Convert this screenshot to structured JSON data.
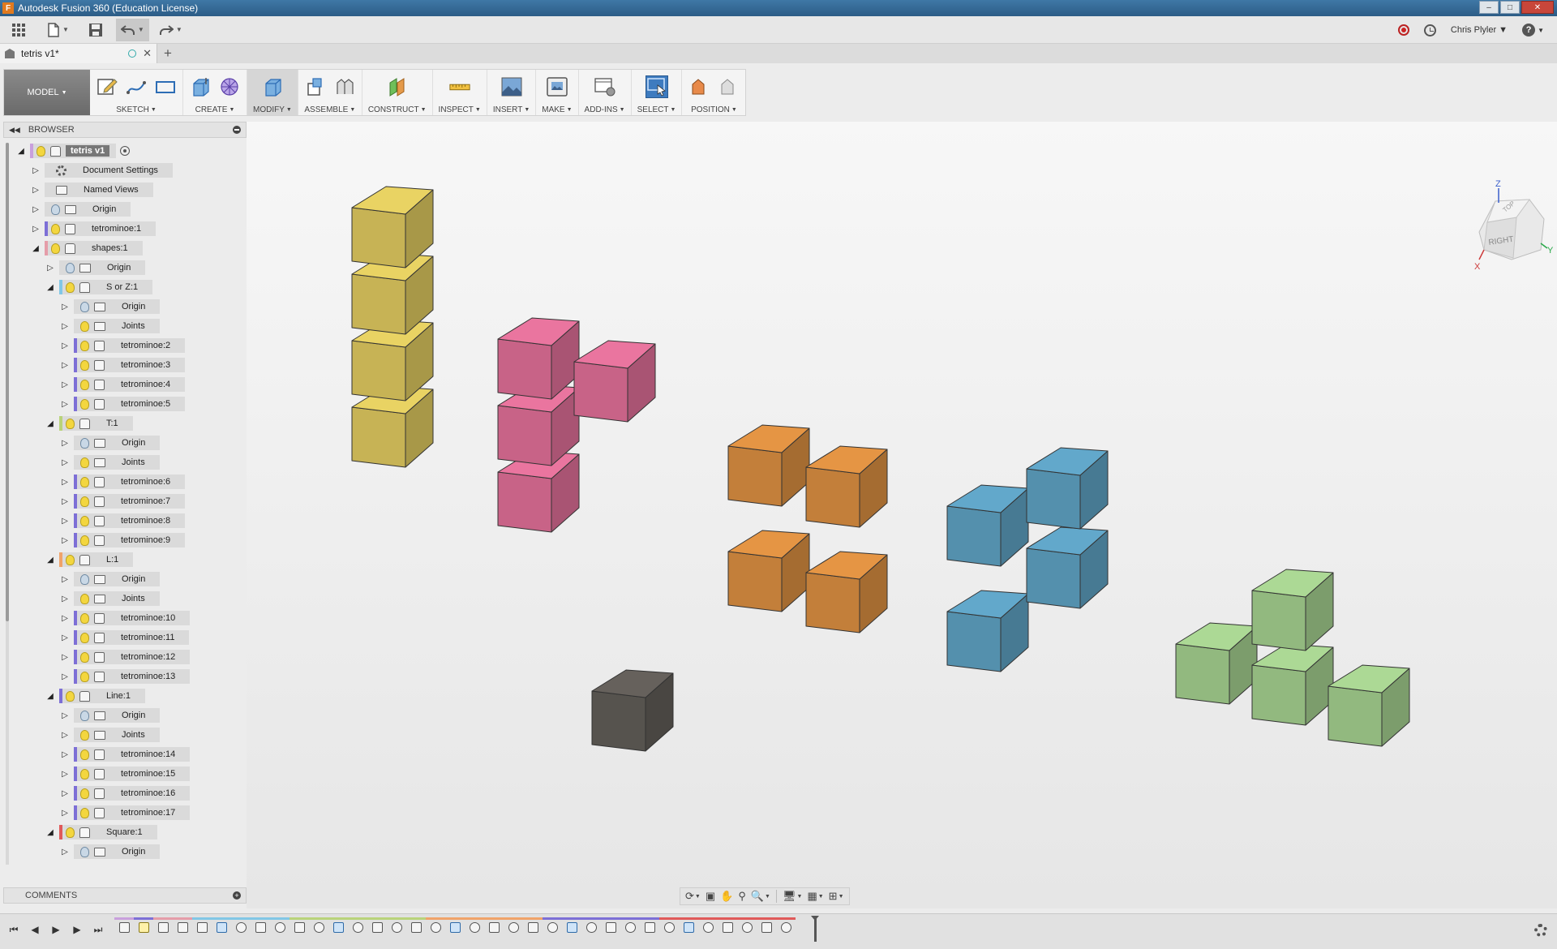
{
  "window": {
    "title": "Autodesk Fusion 360 (Education License)",
    "app_letter": "F"
  },
  "quickbar": {
    "user": "Chris Plyler",
    "help": "?"
  },
  "doc_tab": {
    "name": "tetris v1*"
  },
  "ribbon": {
    "workspace": "MODEL",
    "groups": [
      "SKETCH",
      "CREATE",
      "MODIFY",
      "ASSEMBLE",
      "CONSTRUCT",
      "INSPECT",
      "INSERT",
      "MAKE",
      "ADD-INS",
      "SELECT",
      "POSITION"
    ]
  },
  "browser": {
    "title": "BROWSER",
    "nodes": [
      {
        "label": "tetris v1",
        "icon": "assembly",
        "color": "#c9a0dc",
        "expanded": true,
        "level": 0,
        "root": true
      },
      {
        "label": "Document Settings",
        "icon": "gear",
        "color": "",
        "expanded": false,
        "level": 1
      },
      {
        "label": "Named Views",
        "icon": "folder",
        "color": "",
        "expanded": false,
        "level": 1
      },
      {
        "label": "Origin",
        "icon": "folder",
        "color": "",
        "expanded": false,
        "level": 1,
        "bulb": "off"
      },
      {
        "label": "tetrominoe:1",
        "icon": "body",
        "color": "#7d6fd6",
        "expanded": false,
        "level": 1,
        "bulb": "on"
      },
      {
        "label": "shapes:1",
        "icon": "component",
        "color": "#e59da9",
        "expanded": true,
        "level": 1,
        "bulb": "on"
      },
      {
        "label": "Origin",
        "icon": "folder",
        "color": "",
        "expanded": false,
        "level": 2,
        "bulb": "off"
      },
      {
        "label": "S or Z:1",
        "icon": "component",
        "color": "#82c7e6",
        "expanded": true,
        "level": 2,
        "bulb": "on"
      },
      {
        "label": "Origin",
        "icon": "folder",
        "color": "",
        "expanded": false,
        "level": 3,
        "bulb": "off"
      },
      {
        "label": "Joints",
        "icon": "folder",
        "color": "",
        "expanded": false,
        "level": 3,
        "bulb": "on"
      },
      {
        "label": "tetrominoe:2",
        "icon": "body",
        "color": "#7d6fd6",
        "expanded": false,
        "level": 3,
        "bulb": "on"
      },
      {
        "label": "tetrominoe:3",
        "icon": "body",
        "color": "#7d6fd6",
        "expanded": false,
        "level": 3,
        "bulb": "on"
      },
      {
        "label": "tetrominoe:4",
        "icon": "body",
        "color": "#7d6fd6",
        "expanded": false,
        "level": 3,
        "bulb": "on"
      },
      {
        "label": "tetrominoe:5",
        "icon": "body",
        "color": "#7d6fd6",
        "expanded": false,
        "level": 3,
        "bulb": "on"
      },
      {
        "label": "T:1",
        "icon": "component",
        "color": "#b9d37a",
        "expanded": true,
        "level": 2,
        "bulb": "on"
      },
      {
        "label": "Origin",
        "icon": "folder",
        "color": "",
        "expanded": false,
        "level": 3,
        "bulb": "off"
      },
      {
        "label": "Joints",
        "icon": "folder",
        "color": "",
        "expanded": false,
        "level": 3,
        "bulb": "on"
      },
      {
        "label": "tetrominoe:6",
        "icon": "body",
        "color": "#7d6fd6",
        "expanded": false,
        "level": 3,
        "bulb": "on"
      },
      {
        "label": "tetrominoe:7",
        "icon": "body",
        "color": "#7d6fd6",
        "expanded": false,
        "level": 3,
        "bulb": "on"
      },
      {
        "label": "tetrominoe:8",
        "icon": "body",
        "color": "#7d6fd6",
        "expanded": false,
        "level": 3,
        "bulb": "on"
      },
      {
        "label": "tetrominoe:9",
        "icon": "body",
        "color": "#7d6fd6",
        "expanded": false,
        "level": 3,
        "bulb": "on"
      },
      {
        "label": "L:1",
        "icon": "component",
        "color": "#f0a36a",
        "expanded": true,
        "level": 2,
        "bulb": "on"
      },
      {
        "label": "Origin",
        "icon": "folder",
        "color": "",
        "expanded": false,
        "level": 3,
        "bulb": "off"
      },
      {
        "label": "Joints",
        "icon": "folder",
        "color": "",
        "expanded": false,
        "level": 3,
        "bulb": "on"
      },
      {
        "label": "tetrominoe:10",
        "icon": "body",
        "color": "#7d6fd6",
        "expanded": false,
        "level": 3,
        "bulb": "on"
      },
      {
        "label": "tetrominoe:11",
        "icon": "body",
        "color": "#7d6fd6",
        "expanded": false,
        "level": 3,
        "bulb": "on"
      },
      {
        "label": "tetrominoe:12",
        "icon": "body",
        "color": "#7d6fd6",
        "expanded": false,
        "level": 3,
        "bulb": "on"
      },
      {
        "label": "tetrominoe:13",
        "icon": "body",
        "color": "#7d6fd6",
        "expanded": false,
        "level": 3,
        "bulb": "on"
      },
      {
        "label": "Line:1",
        "icon": "component",
        "color": "#7d6fd6",
        "expanded": true,
        "level": 2,
        "bulb": "on"
      },
      {
        "label": "Origin",
        "icon": "folder",
        "color": "",
        "expanded": false,
        "level": 3,
        "bulb": "off"
      },
      {
        "label": "Joints",
        "icon": "folder",
        "color": "",
        "expanded": false,
        "level": 3,
        "bulb": "on"
      },
      {
        "label": "tetrominoe:14",
        "icon": "body",
        "color": "#7d6fd6",
        "expanded": false,
        "level": 3,
        "bulb": "on"
      },
      {
        "label": "tetrominoe:15",
        "icon": "body",
        "color": "#7d6fd6",
        "expanded": false,
        "level": 3,
        "bulb": "on"
      },
      {
        "label": "tetrominoe:16",
        "icon": "body",
        "color": "#7d6fd6",
        "expanded": false,
        "level": 3,
        "bulb": "on"
      },
      {
        "label": "tetrominoe:17",
        "icon": "body",
        "color": "#7d6fd6",
        "expanded": false,
        "level": 3,
        "bulb": "on"
      },
      {
        "label": "Square:1",
        "icon": "component",
        "color": "#e05a5a",
        "expanded": true,
        "level": 2,
        "bulb": "on"
      },
      {
        "label": "Origin",
        "icon": "folder",
        "color": "",
        "expanded": false,
        "level": 3,
        "bulb": "off"
      }
    ]
  },
  "comments": {
    "title": "COMMENTS"
  },
  "viewcube": {
    "face_right": "RIGHT",
    "face_top": "TOP",
    "axis_z": "Z",
    "axis_y": "Y",
    "axis_x": "X"
  },
  "shape_colors": {
    "line": "#d8c35c",
    "s_or_z": "#d96c93",
    "square": "#d48a3f",
    "z_piece": "#5b9cbc",
    "single": "#5e5a55",
    "t_piece": "#9fc98a"
  },
  "timeline": {
    "feature_count": 35
  }
}
